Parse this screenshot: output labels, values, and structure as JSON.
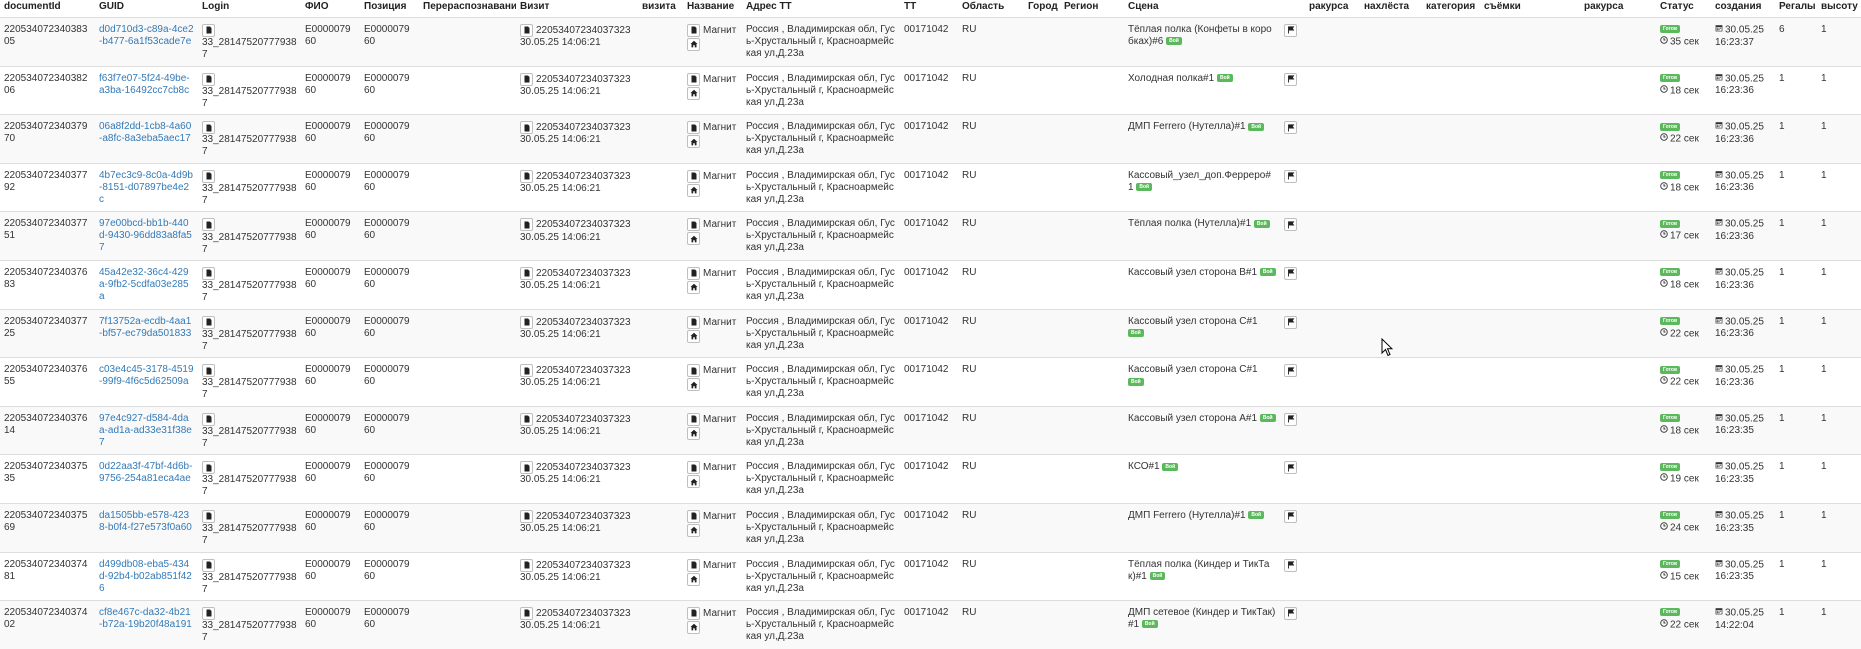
{
  "columns": [
    "documentId",
    "GUID",
    "Login",
    "ФИО",
    "Позиция",
    "Перераспознавание",
    "Визит",
    "визита",
    "Название",
    "Адрес ТТ",
    "ТТ",
    "Область",
    "Город",
    "Регион",
    "Сцена",
    "",
    "ракурса",
    "нахлёста",
    "категория",
    "съёмки",
    "ракурса",
    "Статус",
    "создания",
    "Регалы",
    "высоту"
  ],
  "rows": [
    {
      "documentId": "22053407234038305",
      "guid": "d0d710d3-c89a-4ce2-b477-6a1f53cade7e",
      "login": "33_281475207779387",
      "fio": "E000007960",
      "position": "E000007960",
      "visit_id": "22053407234037323",
      "visit_date": "30.05.25 14:06:21",
      "shop_name": "Магнит",
      "address": "Россия , Владимирская обл, Гусь-Хрустальный г, Красноармейская ул,Д.23а",
      "tt": "00171042",
      "oblast": "RU",
      "scene": "Тёплая полка (Конфеты в коробках)#6",
      "scene_badge": "Вой",
      "status": "Готов",
      "duration": "35 сек",
      "created_date": "30.05.25",
      "created_time": "16:23:37",
      "regaly": "6",
      "vysotu": "1"
    },
    {
      "documentId": "22053407234038206",
      "guid": "f63f7e07-5f24-49be-a3ba-16492cc7cb8c",
      "login": "33_281475207779387",
      "fio": "E000007960",
      "position": "E000007960",
      "visit_id": "22053407234037323",
      "visit_date": "30.05.25 14:06:21",
      "shop_name": "Магнит",
      "address": "Россия , Владимирская обл, Гусь-Хрустальный г, Красноармейская ул,Д.23а",
      "tt": "00171042",
      "oblast": "RU",
      "scene": "Холодная полка#1",
      "scene_badge": "Вой",
      "status": "Готов",
      "duration": "18 сек",
      "created_date": "30.05.25",
      "created_time": "16:23:36",
      "regaly": "1",
      "vysotu": "1"
    },
    {
      "documentId": "22053407234037970",
      "guid": "06a8f2dd-1cb8-4a60-a8fc-8a3eba5aec17",
      "login": "33_281475207779387",
      "fio": "E000007960",
      "position": "E000007960",
      "visit_id": "22053407234037323",
      "visit_date": "30.05.25 14:06:21",
      "shop_name": "Магнит",
      "address": "Россия , Владимирская обл, Гусь-Хрустальный г, Красноармейская ул,Д.23а",
      "tt": "00171042",
      "oblast": "RU",
      "scene": "ДМП Ferrero (Нутелла)#1",
      "scene_badge": "Вой",
      "status": "Готов",
      "duration": "22 сек",
      "created_date": "30.05.25",
      "created_time": "16:23:36",
      "regaly": "1",
      "vysotu": "1"
    },
    {
      "documentId": "22053407234037792",
      "guid": "4b7ec3c9-8c0a-4d9b-8151-d07897be4e2c",
      "login": "33_281475207779387",
      "fio": "E000007960",
      "position": "E000007960",
      "visit_id": "22053407234037323",
      "visit_date": "30.05.25 14:06:21",
      "shop_name": "Магнит",
      "address": "Россия , Владимирская обл, Гусь-Хрустальный г, Красноармейская ул,Д.23а",
      "tt": "00171042",
      "oblast": "RU",
      "scene": "Кассовый_узел_доп.Ферреро#1",
      "scene_badge": "Вой",
      "status": "Готов",
      "duration": "18 сек",
      "created_date": "30.05.25",
      "created_time": "16:23:36",
      "regaly": "1",
      "vysotu": "1"
    },
    {
      "documentId": "22053407234037751",
      "guid": "97e00bcd-bb1b-440d-9430-96dd83a8fa57",
      "login": "33_281475207779387",
      "fio": "E000007960",
      "position": "E000007960",
      "visit_id": "22053407234037323",
      "visit_date": "30.05.25 14:06:21",
      "shop_name": "Магнит",
      "address": "Россия , Владимирская обл, Гусь-Хрустальный г, Красноармейская ул,Д.23а",
      "tt": "00171042",
      "oblast": "RU",
      "scene": "Тёплая полка (Нутелла)#1",
      "scene_badge": "Вой",
      "status": "Готов",
      "duration": "17 сек",
      "created_date": "30.05.25",
      "created_time": "16:23:36",
      "regaly": "1",
      "vysotu": "1"
    },
    {
      "documentId": "22053407234037683",
      "guid": "45a42e32-36c4-429a-9fb2-5cdfa03e285a",
      "login": "33_281475207779387",
      "fio": "E000007960",
      "position": "E000007960",
      "visit_id": "22053407234037323",
      "visit_date": "30.05.25 14:06:21",
      "shop_name": "Магнит",
      "address": "Россия , Владимирская обл, Гусь-Хрустальный г, Красноармейская ул,Д.23а",
      "tt": "00171042",
      "oblast": "RU",
      "scene": "Кассовый узел сторона B#1",
      "scene_badge": "Вой",
      "status": "Готов",
      "duration": "18 сек",
      "created_date": "30.05.25",
      "created_time": "16:23:36",
      "regaly": "1",
      "vysotu": "1"
    },
    {
      "documentId": "22053407234037725",
      "guid": "7f13752a-ecdb-4aa1-bf57-ec79da501833",
      "login": "33_281475207779387",
      "fio": "E000007960",
      "position": "E000007960",
      "visit_id": "22053407234037323",
      "visit_date": "30.05.25 14:06:21",
      "shop_name": "Магнит",
      "address": "Россия , Владимирская обл, Гусь-Хрустальный г, Красноармейская ул,Д.23а",
      "tt": "00171042",
      "oblast": "RU",
      "scene": "Кассовый узел сторона C#1",
      "scene_badge": "Вой",
      "status": "Готов",
      "duration": "22 сек",
      "created_date": "30.05.25",
      "created_time": "16:23:36",
      "regaly": "1",
      "vysotu": "1"
    },
    {
      "documentId": "22053407234037655",
      "guid": "c03e4c45-3178-4519-99f9-4f6c5d62509a",
      "login": "33_281475207779387",
      "fio": "E000007960",
      "position": "E000007960",
      "visit_id": "22053407234037323",
      "visit_date": "30.05.25 14:06:21",
      "shop_name": "Магнит",
      "address": "Россия , Владимирская обл, Гусь-Хрустальный г, Красноармейская ул,Д.23а",
      "tt": "00171042",
      "oblast": "RU",
      "scene": "Кассовый узел сторона C#1",
      "scene_badge": "Вой",
      "status": "Готов",
      "duration": "22 сек",
      "created_date": "30.05.25",
      "created_time": "16:23:36",
      "regaly": "1",
      "vysotu": "1"
    },
    {
      "documentId": "22053407234037614",
      "guid": "97e4c927-d584-4daa-ad1a-ad33e31f38e7",
      "login": "33_281475207779387",
      "fio": "E000007960",
      "position": "E000007960",
      "visit_id": "22053407234037323",
      "visit_date": "30.05.25 14:06:21",
      "shop_name": "Магнит",
      "address": "Россия , Владимирская обл, Гусь-Хрустальный г, Красноармейская ул,Д.23а",
      "tt": "00171042",
      "oblast": "RU",
      "scene": "Кассовый узел сторона A#1",
      "scene_badge": "Вой",
      "status": "Готов",
      "duration": "18 сек",
      "created_date": "30.05.25",
      "created_time": "16:23:35",
      "regaly": "1",
      "vysotu": "1"
    },
    {
      "documentId": "22053407234037535",
      "guid": "0d22aa3f-47bf-4d6b-9756-254a81eca4ae",
      "login": "33_281475207779387",
      "fio": "E000007960",
      "position": "E000007960",
      "visit_id": "22053407234037323",
      "visit_date": "30.05.25 14:06:21",
      "shop_name": "Магнит",
      "address": "Россия , Владимирская обл, Гусь-Хрустальный г, Красноармейская ул,Д.23а",
      "tt": "00171042",
      "oblast": "RU",
      "scene": "КСО#1",
      "scene_badge": "Вой",
      "status": "Готов",
      "duration": "19 сек",
      "created_date": "30.05.25",
      "created_time": "16:23:35",
      "regaly": "1",
      "vysotu": "1"
    },
    {
      "documentId": "22053407234037569",
      "guid": "da1505bb-e578-4238-b0f4-f27e573f0a60",
      "login": "33_281475207779387",
      "fio": "E000007960",
      "position": "E000007960",
      "visit_id": "22053407234037323",
      "visit_date": "30.05.25 14:06:21",
      "shop_name": "Магнит",
      "address": "Россия , Владимирская обл, Гусь-Хрустальный г, Красноармейская ул,Д.23а",
      "tt": "00171042",
      "oblast": "RU",
      "scene": "ДМП Ferrero (Нутелла)#1",
      "scene_badge": "Вой",
      "status": "Готов",
      "duration": "24 сек",
      "created_date": "30.05.25",
      "created_time": "16:23:35",
      "regaly": "1",
      "vysotu": "1"
    },
    {
      "documentId": "22053407234037481",
      "guid": "d499db08-eba5-434d-92b4-b02ab851f426",
      "login": "33_281475207779387",
      "fio": "E000007960",
      "position": "E000007960",
      "visit_id": "22053407234037323",
      "visit_date": "30.05.25 14:06:21",
      "shop_name": "Магнит",
      "address": "Россия , Владимирская обл, Гусь-Хрустальный г, Красноармейская ул,Д.23а",
      "tt": "00171042",
      "oblast": "RU",
      "scene": "Тёплая полка (Киндер и ТикТак)#1",
      "scene_badge": "Вой",
      "status": "Готов",
      "duration": "15 сек",
      "created_date": "30.05.25",
      "created_time": "16:23:35",
      "regaly": "1",
      "vysotu": "1"
    },
    {
      "documentId": "22053407234037402",
      "guid": "cf8e467c-da32-4b21-b72a-19b20f48a191",
      "login": "33_281475207779387",
      "fio": "E000007960",
      "position": "E000007960",
      "visit_id": "22053407234037323",
      "visit_date": "30.05.25 14:06:21",
      "shop_name": "Магнит",
      "address": "Россия , Владимирская обл, Гусь-Хрустальный г, Красноармейская ул,Д.23а",
      "tt": "00171042",
      "oblast": "RU",
      "scene": "ДМП сетевое (Киндер и ТикТак)#1",
      "scene_badge": "Вой",
      "status": "Готов",
      "duration": "22 сек",
      "created_date": "30.05.25",
      "created_time": "14:22:04",
      "regaly": "1",
      "vysotu": "1"
    }
  ],
  "colors": {
    "link": "#337ab7",
    "badge": "#5cb85c",
    "row_alt": "#f9f9f9",
    "border": "#dddddd"
  },
  "icons": {
    "doc": "file-icon",
    "shop": "home-icon",
    "flag": "flag-icon",
    "clock": "clock-icon",
    "calendar": "calendar-icon"
  }
}
